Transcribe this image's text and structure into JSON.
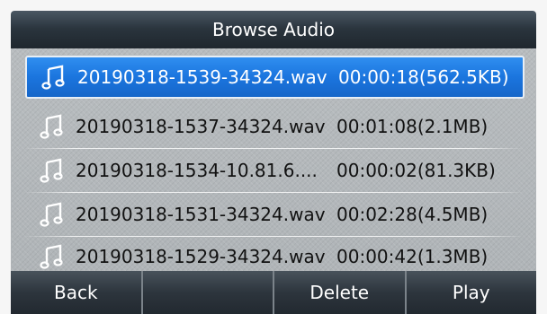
{
  "title": "Browse Audio",
  "files": [
    {
      "name": "20190318-1539-34324.wav",
      "info": "00:00:18(562.5KB)",
      "selected": true
    },
    {
      "name": "20190318-1537-34324.wav",
      "info": "00:01:08(2.1MB)",
      "selected": false
    },
    {
      "name": "20190318-1534-10.81.6....",
      "info": "00:00:02(81.3KB)",
      "selected": false
    },
    {
      "name": "20190318-1531-34324.wav",
      "info": "00:02:28(4.5MB)",
      "selected": false
    },
    {
      "name": "20190318-1529-34324.wav",
      "info": "00:00:42(1.3MB)",
      "selected": false
    }
  ],
  "softkeys": [
    "Back",
    "",
    "Delete",
    "Play"
  ],
  "icons": {
    "file": "music-note-icon"
  },
  "colors": {
    "selection": "#1b75de",
    "titlebar": "#2a343d",
    "softkey": "#2d353d"
  }
}
